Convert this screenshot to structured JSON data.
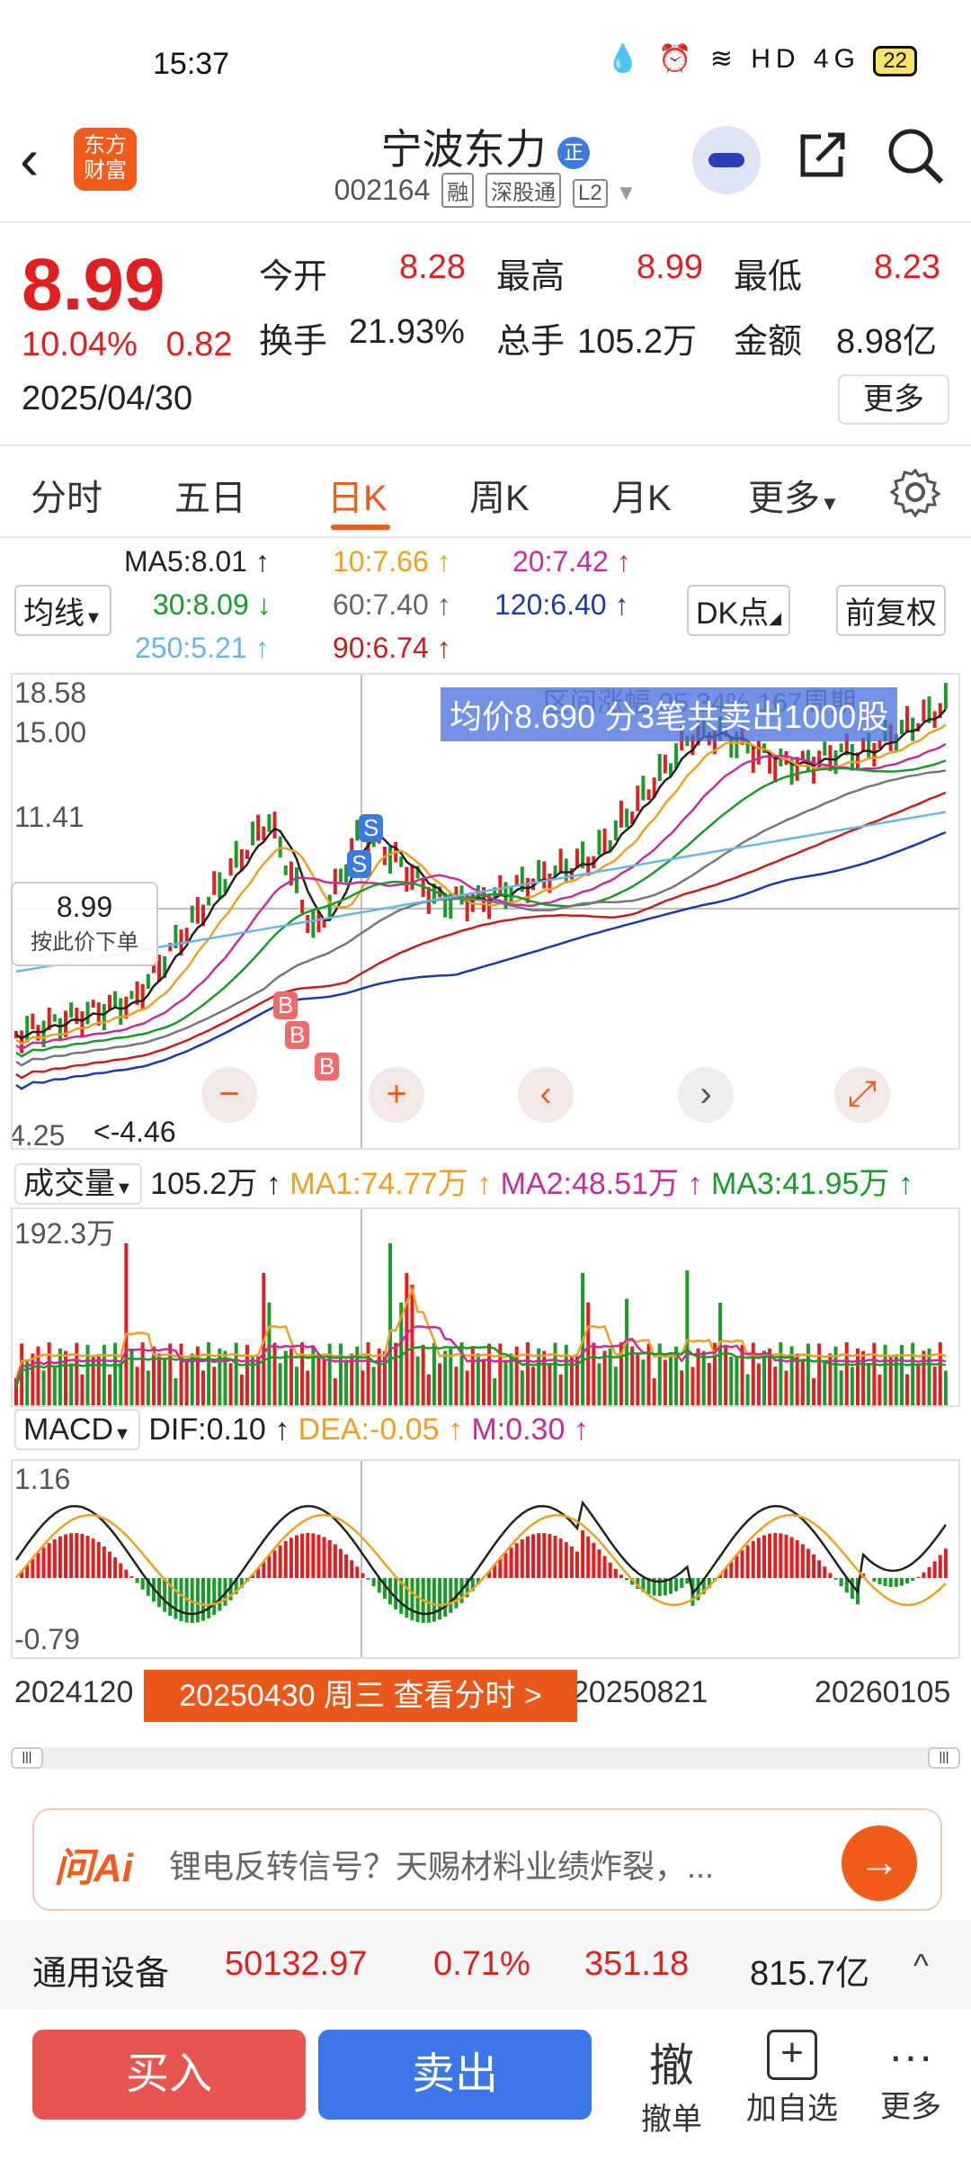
{
  "status": {
    "time": "15:37",
    "icons": "💧 ⏰ ≋ HD 4G",
    "battery": "22"
  },
  "header": {
    "stock_name": "宁波东力",
    "code": "002164",
    "tags": [
      "融",
      "深股通",
      "L2"
    ],
    "logo_line1": "东方",
    "logo_line2": "财富",
    "badge": "正"
  },
  "quote": {
    "price": "8.99",
    "pct": "10.04%",
    "chg": "0.82",
    "date": "2025/04/30",
    "open_label": "今开",
    "open": "8.28",
    "high_label": "最高",
    "high": "8.99",
    "low_label": "最低",
    "low": "8.23",
    "turnover_label": "换手",
    "turnover": "21.93%",
    "vol_label": "总手",
    "vol": "105.2万",
    "amount_label": "金额",
    "amount": "8.98亿",
    "more": "更多"
  },
  "tabs": [
    "分时",
    "五日",
    "日K",
    "周K",
    "月K",
    "更多"
  ],
  "ma": {
    "selector": "均线",
    "ma5": "MA5:8.01",
    "ma10": "10:7.66",
    "ma20": "20:7.42",
    "ma30": "30:8.09",
    "ma60": "60:7.40",
    "ma120": "120:6.40",
    "ma250": "250:5.21",
    "ma90": "90:6.74",
    "dk": "DK点",
    "adjust": "前复权"
  },
  "kline": {
    "y_labels": [
      "18.58",
      "15.00",
      "11.41",
      "4.25"
    ],
    "min_label": "<-4.46",
    "tooltip": "均价8.690 分3笔共卖出1000股",
    "tooltip_under": "区间涨幅 95.34% 167周期",
    "price_box": "8.99",
    "price_box_hint": "按此价下单",
    "ctrl_minus": "−",
    "ctrl_plus": "+",
    "ctrl_left": "‹",
    "ctrl_right": "›",
    "ctrl_expand": "⤢"
  },
  "volume": {
    "selector": "成交量",
    "value": "105.2万",
    "ma1": "MA1:74.77万",
    "ma2": "MA2:48.51万",
    "ma3": "MA3:41.95万",
    "max": "192.3万"
  },
  "macd": {
    "selector": "MACD",
    "dif": "DIF:0.10",
    "dea": "DEA:-0.05",
    "m": "M:0.30",
    "max": "1.16",
    "min": "-0.79"
  },
  "dates": {
    "left": "2024120",
    "mid": "20250821",
    "right": "20260105",
    "pill": "20250430 周三 查看分时 >"
  },
  "ai": {
    "logo": "问Ai",
    "placeholder": "锂电反转信号？天赐材料业绩炸裂，...",
    "go": "→"
  },
  "sector": {
    "name": "通用设备",
    "index": "50132.97",
    "pct": "0.71%",
    "chg": "351.18",
    "amount": "815.7亿",
    "arrow": "^"
  },
  "bottom": {
    "buy": "买入",
    "sell": "卖出",
    "cancel_icon": "撤",
    "cancel": "撤单",
    "add_icon": "+",
    "add": "加自选",
    "more_icon": "···",
    "more": "更多"
  },
  "colors": {
    "up": "#e02020",
    "down": "#1a9a2a",
    "accent": "#f25c1b"
  }
}
